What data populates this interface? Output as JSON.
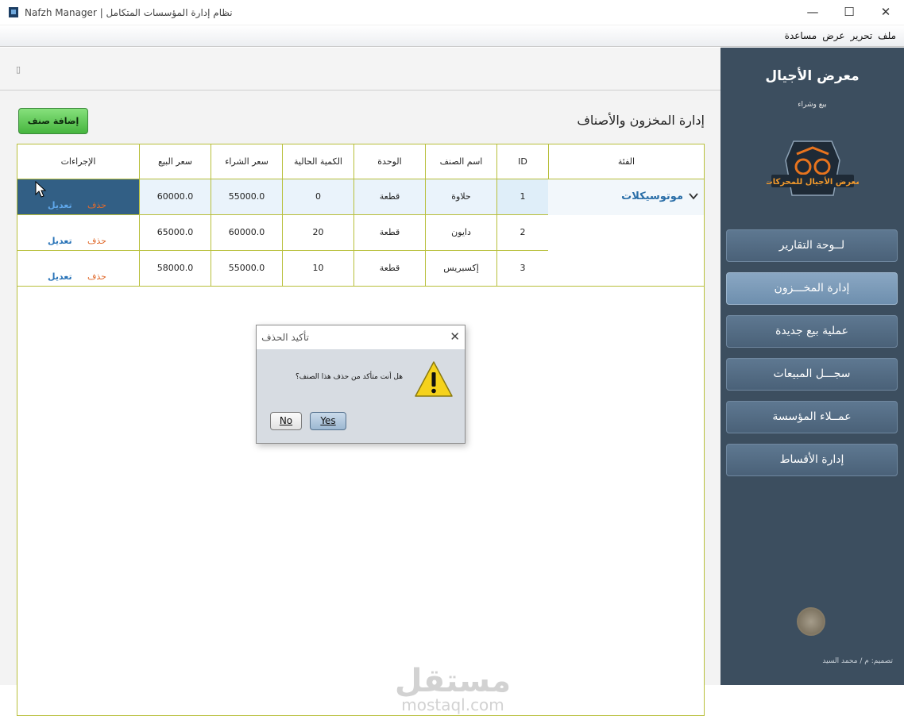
{
  "window": {
    "title": "Nafzh Manager | نظام إدارة المؤسسات المتكامل",
    "minimize": "—",
    "maximize": "☐",
    "close": "✕"
  },
  "menu": [
    "ملف",
    "تحرير",
    "عرض",
    "مساعدة"
  ],
  "toolbar": {
    "strip_glyph": "▯"
  },
  "page": {
    "title": "إدارة المخزون والأصناف",
    "add_button": "إضافة صنف"
  },
  "table": {
    "headers": {
      "category": "الفئة",
      "id": "ID",
      "name": "اسم الصنف",
      "unit": "الوحدة",
      "qty": "الكمية الحالية",
      "buy": "سعر الشراء",
      "sell": "سعر البيع",
      "actions": "الإجراءات"
    },
    "category_group": "موتوسيكلات",
    "rows": [
      {
        "id": "1",
        "name": "حلاوة",
        "unit": "قطعة",
        "qty": "0",
        "buy": "55000.0",
        "sell": "60000.0",
        "delete": "حذف",
        "edit": "تعديل"
      },
      {
        "id": "2",
        "name": "دايون",
        "unit": "قطعة",
        "qty": "20",
        "buy": "60000.0",
        "sell": "65000.0",
        "delete": "حذف",
        "edit": "تعديل"
      },
      {
        "id": "3",
        "name": "إكسبريس",
        "unit": "قطعة",
        "qty": "10",
        "buy": "55000.0",
        "sell": "58000.0",
        "delete": "حذف",
        "edit": "تعديل"
      }
    ]
  },
  "watermark": {
    "arabic": "مستقل",
    "latin": "mostaql.com"
  },
  "sidebar": {
    "brand": "معرض الأجيال",
    "subtitle": "بيع وشراء",
    "logo_text": "معرض الأجيال للمحركات",
    "items": [
      {
        "label": "لــوحة التقارير"
      },
      {
        "label": "إدارة المخـــزون",
        "active": true
      },
      {
        "label": "عملية بيع جديدة"
      },
      {
        "label": "سجـــل المبيعات"
      },
      {
        "label": "عمــلاء المؤسسة"
      },
      {
        "label": "إدارة الأقساط"
      }
    ],
    "credit": "تصميم: م / محمد السيد"
  },
  "dialog": {
    "title": "تأكيد الحذف",
    "close": "✕",
    "message": "هل أنت متأكد من حذف هذا الصنف؟",
    "no": "No",
    "yes": "Yes"
  },
  "colors": {
    "sidebar": "#3c4e5f",
    "table_border": "#b8bf3a",
    "add_button": "#46b53e",
    "selected_row": "#325f85",
    "delete_link": "#e06a2c",
    "edit_link": "#2a74b8"
  }
}
